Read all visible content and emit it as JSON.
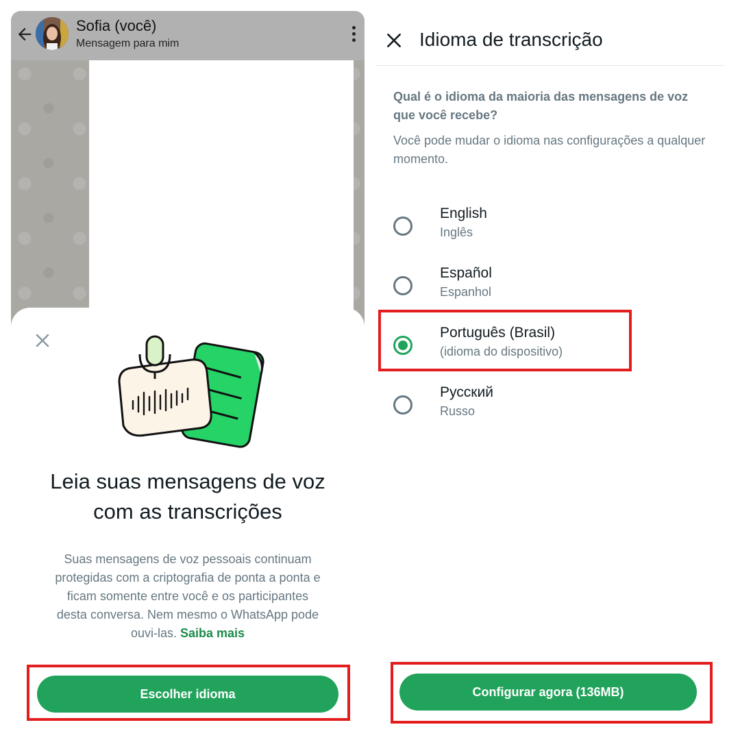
{
  "chat": {
    "name": "Sofia (você)",
    "subtitle": "Mensagem para mim"
  },
  "sheet": {
    "title": "Leia suas mensagens de voz com as transcrições",
    "description": "Suas mensagens de voz pessoais continuam protegidas com a criptografia de ponta a ponta e ficam somente entre você e os participantes desta conversa. Nem mesmo o WhatsApp pode ouvi-las.",
    "link": "Saiba mais",
    "button": "Escolher idioma"
  },
  "language_screen": {
    "title": "Idioma de transcrição",
    "question": "Qual é o idioma da maioria das mensagens de voz que você recebe?",
    "hint": "Você pode mudar o idioma nas configurações a qualquer momento.",
    "options": [
      {
        "name": "English",
        "sub": "Inglês",
        "selected": false
      },
      {
        "name": "Español",
        "sub": "Espanhol",
        "selected": false
      },
      {
        "name": "Português (Brasil)",
        "sub": "(idioma do dispositivo)",
        "selected": true
      },
      {
        "name": "Русский",
        "sub": "Russo",
        "selected": false
      }
    ],
    "button": "Configurar agora (136MB)"
  },
  "colors": {
    "accent_green": "#21a35b",
    "highlight_red": "#e31d1d",
    "secondary_text": "#667781"
  },
  "icons": [
    "back-arrow-icon",
    "avatar",
    "kebab-menu-icon",
    "close-icon",
    "voice-transcription-illustration",
    "radio-button"
  ]
}
